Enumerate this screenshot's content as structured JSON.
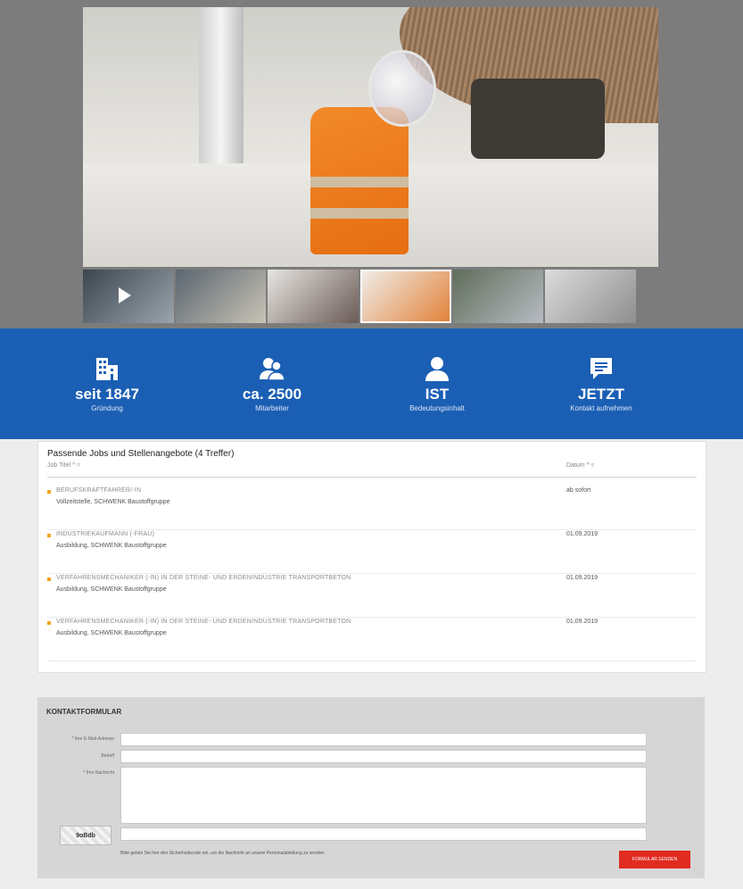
{
  "gallery": {
    "thumbnails": [
      "video",
      "office",
      "desk",
      "meeting",
      "vest",
      "workshop"
    ]
  },
  "stats": [
    {
      "icon": "building-icon",
      "value": "seit 1847",
      "caption": "Gründung"
    },
    {
      "icon": "people-icon",
      "value": "ca. 2500",
      "caption": "Mitarbeiter"
    },
    {
      "icon": "person-icon",
      "value": "IST",
      "caption": "Bedeutungsinhalt"
    },
    {
      "icon": "chat-icon",
      "value": "JETZT",
      "caption": "Kontakt aufnehmen"
    }
  ],
  "jobs": {
    "heading": "Passende Jobs und Stellenangebote (4 Treffer)",
    "col_job": "Job Titel ^ ▿",
    "col_date": "Datum ^ ▿",
    "rows": [
      {
        "title": "BERUFSKRAFTFAHRER/-IN",
        "sub": "Vollzeitstelle, SCHWENK Baustoffgruppe",
        "date": "ab sofort"
      },
      {
        "title": "INDUSTRIEKAUFMANN (-FRAU)",
        "sub": "Ausbildung, SCHWENK Baustoffgruppe",
        "date": "01.09.2019"
      },
      {
        "title": "VERFAHRENSMECHANIKER (-IN) IN DER STEINE- UND ERDENINDUSTRIE TRANSPORTBETON",
        "sub": "Ausbildung, SCHWENK Baustoffgruppe",
        "date": "01.09.2019"
      },
      {
        "title": "VERFAHRENSMECHANIKER (-IN) IN DER STEINE- UND ERDENINDUSTRIE TRANSPORTBETON",
        "sub": "Ausbildung, SCHWENK Baustoffgruppe",
        "date": "01.09.2019"
      }
    ]
  },
  "contact": {
    "heading": "KONTAKTFORMULAR",
    "labels": [
      "* Ihre E-Mail-Adresse",
      "Betreff",
      "* Ihre Nachricht"
    ],
    "captcha_text": "9oBdb",
    "note": "Bitte geben Sie hier den Sicherheitscode ein, um die Nachricht an unsere Personalabteilung zu senden.",
    "send_label": "FORMULAR SENDEN"
  },
  "colors": {
    "blue": "#1b5fb5",
    "orange": "#f2a31b",
    "red": "#e02b20"
  }
}
